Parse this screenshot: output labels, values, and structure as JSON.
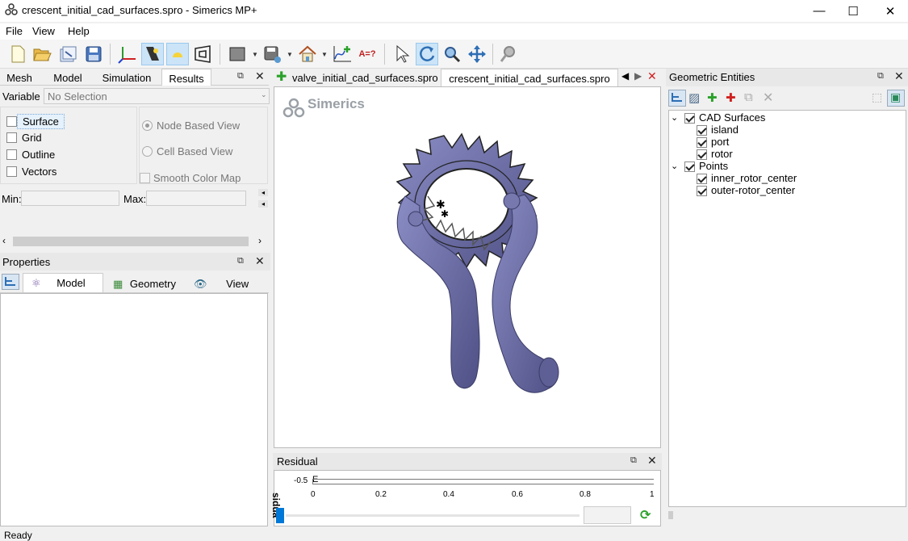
{
  "window": {
    "title": "crescent_initial_cad_surfaces.spro - Simerics MP+",
    "minimize": "—",
    "maximize": "☐",
    "close": "✕"
  },
  "menu": [
    "File",
    "View",
    "Help"
  ],
  "left_tabs": [
    "Mesh",
    "Model",
    "Simulation",
    "Results"
  ],
  "results": {
    "variable_label": "Variable",
    "variable_value": "No Selection",
    "checks": [
      {
        "label": "Surface",
        "checked": false
      },
      {
        "label": "Grid",
        "checked": false
      },
      {
        "label": "Outline",
        "checked": false
      },
      {
        "label": "Vectors",
        "checked": false
      }
    ],
    "node_based": "Node Based View",
    "cell_based": "Cell Based View",
    "smooth": "Smooth Color Map",
    "min_label": "Min:",
    "max_label": "Max:"
  },
  "properties": {
    "title": "Properties",
    "tabs": [
      "Model",
      "Geometry",
      "View"
    ]
  },
  "doc_tabs": [
    "valve_initial_cad_surfaces.spro",
    "crescent_initial_cad_surfaces.spro"
  ],
  "viewport": {
    "logo_text": "Simerics"
  },
  "residual": {
    "title": "Residual",
    "ylabel": "sidua",
    "ytick": "-0.5",
    "ytick_e": "E",
    "xticks": [
      "0",
      "0.2",
      "0.4",
      "0.6",
      "0.8",
      "1"
    ]
  },
  "geom": {
    "title": "Geometric Entities",
    "tree": [
      {
        "label": "CAD Surfaces",
        "checked": true,
        "children": [
          "island",
          "port",
          "rotor"
        ]
      },
      {
        "label": "Points",
        "checked": true,
        "children": [
          "inner_rotor_center",
          "outer-rotor_center"
        ]
      }
    ]
  },
  "status": "Ready",
  "colors": {
    "model": "#6b6da0",
    "accent": "#0078d7",
    "green_plus": "#2aa12a"
  }
}
